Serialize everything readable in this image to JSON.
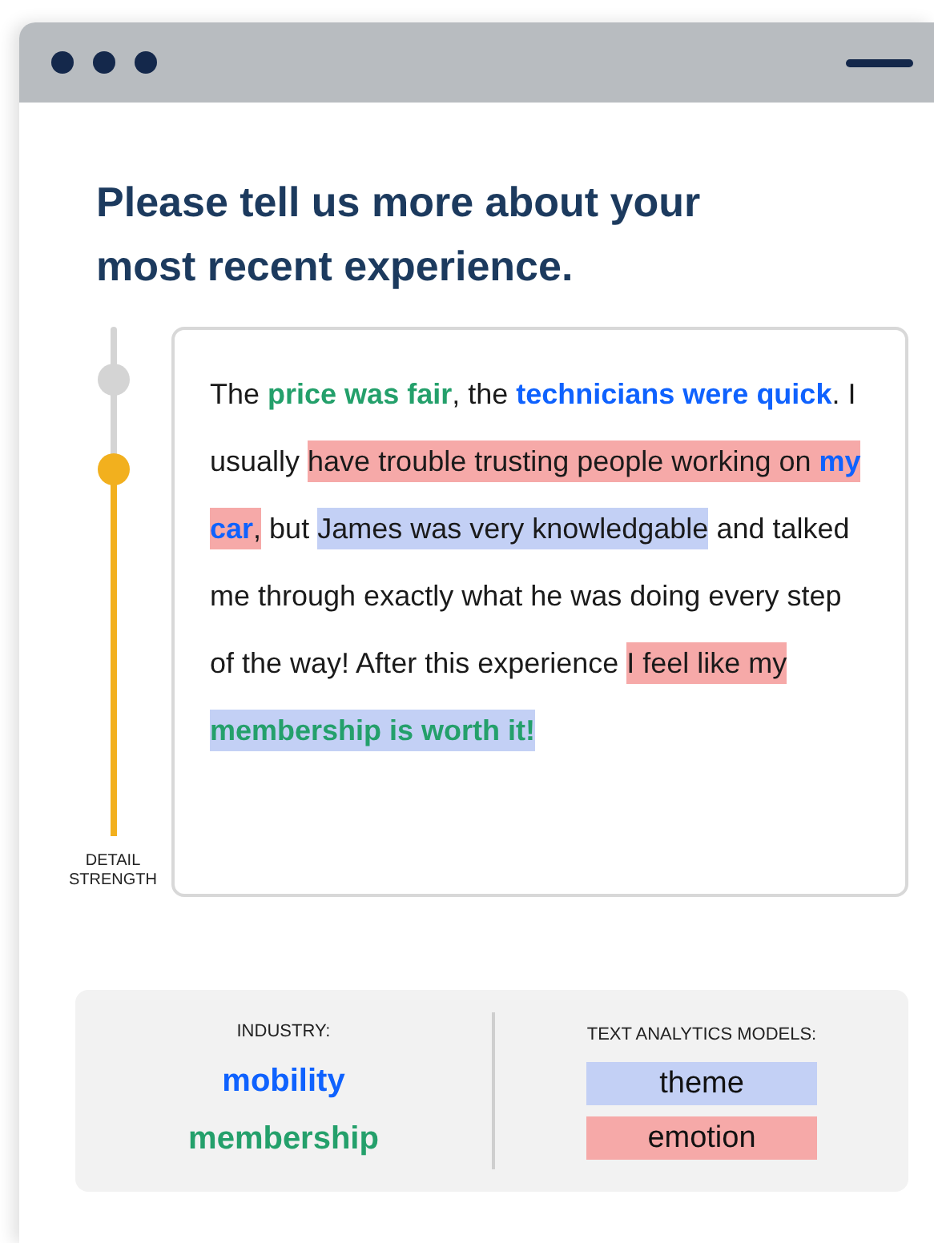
{
  "heading": "Please tell us more about your most recent experience.",
  "slider": {
    "label": "DETAIL STRENGTH",
    "level": 0.72
  },
  "review": [
    {
      "kind": "plain",
      "text": "The "
    },
    {
      "kind": "plain",
      "text": "price was fair",
      "color": "#24a06b"
    },
    {
      "kind": "plain",
      "text": ",  the "
    },
    {
      "kind": "plain",
      "text": "technicians were quick",
      "color": "#0f62fe"
    },
    {
      "kind": "plain",
      "text": ". I usually "
    },
    {
      "kind": "emotion",
      "text": "have trouble trusting people working on "
    },
    {
      "kind": "emotion",
      "text": "my car",
      "color": "#0f62fe"
    },
    {
      "kind": "emotion",
      "text": ","
    },
    {
      "kind": "plain",
      "text": " but "
    },
    {
      "kind": "theme",
      "text": "James was very knowledgable"
    },
    {
      "kind": "plain",
      "text": " and talked me through exactly what he was doing every step of the way! After this experience "
    },
    {
      "kind": "emotion",
      "text": "I feel like my "
    },
    {
      "kind": "theme",
      "text": "membership is worth it!",
      "color": "#24a06b"
    }
  ],
  "industry": {
    "label": "INDUSTRY:",
    "items": [
      {
        "text": "mobility",
        "color": "#0f62fe"
      },
      {
        "text": "membership",
        "color": "#24a06b"
      }
    ]
  },
  "models": {
    "label": "TEXT ANALYTICS MODELS:",
    "items": [
      {
        "kind": "theme",
        "text": "theme",
        "color": "#c3d0f5"
      },
      {
        "kind": "emotion",
        "text": "emotion",
        "color": "#f6a9a8"
      }
    ]
  }
}
